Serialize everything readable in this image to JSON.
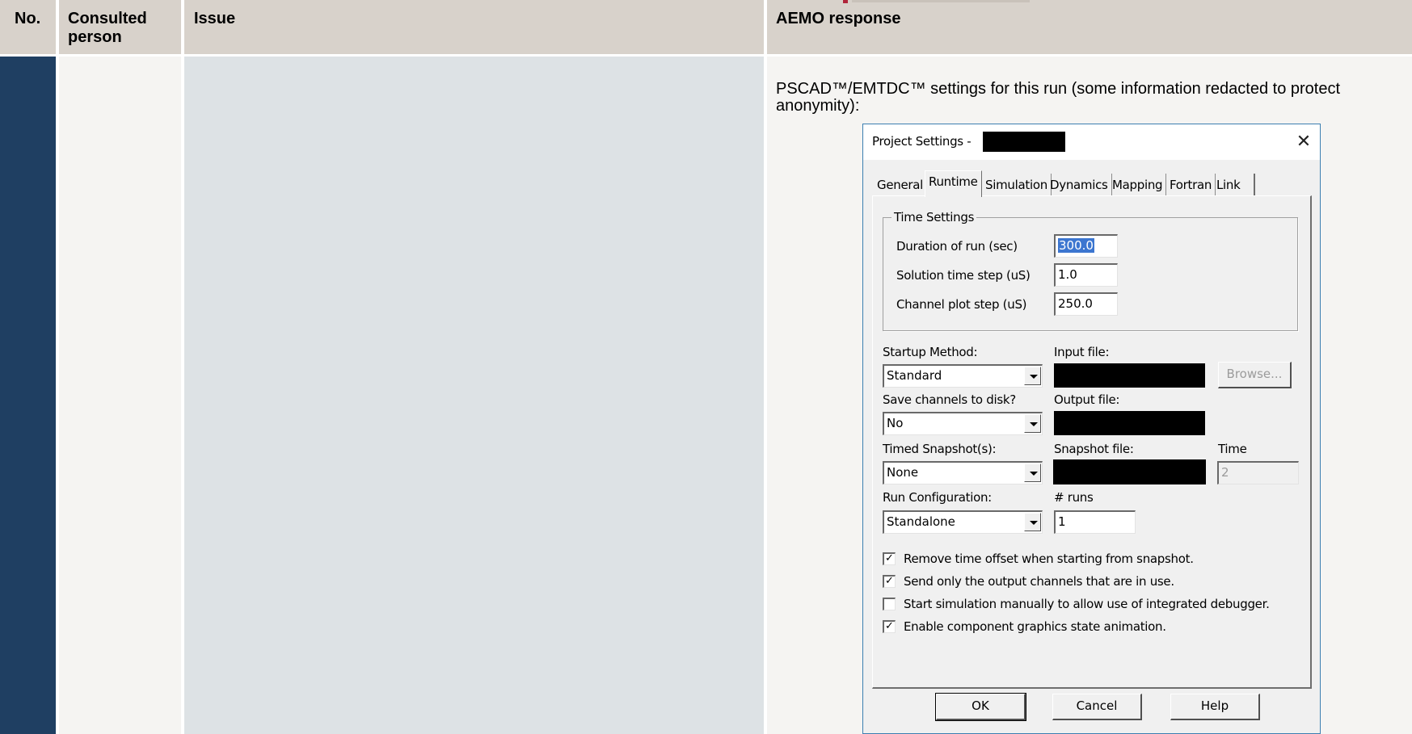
{
  "table": {
    "headers": {
      "no": "No.",
      "consulted_person": "Consulted person",
      "issue": "Issue",
      "aemo_response": "AEMO response"
    },
    "response_text": "PSCAD™/EMTDC™ settings for this run (some information redacted to protect anonymity):"
  },
  "dialog": {
    "title": "Project Settings -",
    "close_glyph": "✕",
    "tabs": [
      "General",
      "Runtime",
      "Simulation",
      "Dynamics",
      "Mapping",
      "Fortran",
      "Link"
    ],
    "active_tab": "Runtime",
    "time_settings": {
      "title": "Time Settings",
      "duration_label": "Duration of run (sec)",
      "duration_value": "300.0",
      "step_label": "Solution time step (uS)",
      "step_value": "1.0",
      "plot_label": "Channel plot step (uS)",
      "plot_value": "250.0"
    },
    "startup_method_label": "Startup Method:",
    "startup_method_value": "Standard",
    "input_file_label": "Input file:",
    "browse_label": "Browse...",
    "save_channels_label": "Save channels to disk?",
    "save_channels_value": "No",
    "output_file_label": "Output file:",
    "timed_snapshot_label": "Timed Snapshot(s):",
    "timed_snapshot_value": "None",
    "snapshot_file_label": "Snapshot file:",
    "time_label": "Time",
    "time_value": "2",
    "run_config_label": "Run Configuration:",
    "run_config_value": "Standalone",
    "runs_label": "# runs",
    "runs_value": "1",
    "checkboxes": [
      {
        "label": "Remove time offset when starting from snapshot.",
        "checked": true,
        "mark": "✓"
      },
      {
        "label": "Send only the output channels that are in use.",
        "checked": true,
        "mark": "✓"
      },
      {
        "label": "Start simulation manually to allow use of integrated debugger.",
        "checked": false,
        "mark": ""
      },
      {
        "label": "Enable component graphics state animation.",
        "checked": true,
        "mark": "✓"
      }
    ],
    "buttons": {
      "ok": "OK",
      "cancel": "Cancel",
      "help": "Help"
    }
  }
}
